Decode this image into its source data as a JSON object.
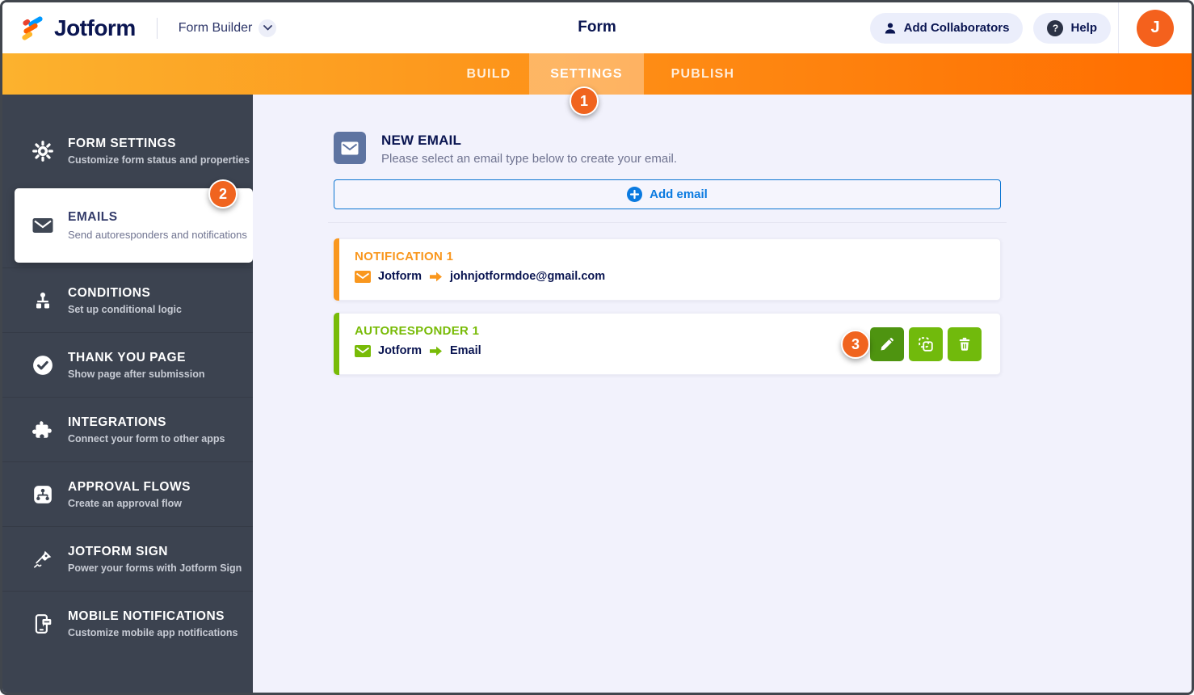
{
  "header": {
    "brand": "Jotform",
    "product": "Form Builder",
    "page_title": "Form",
    "add_collaborators": "Add Collaborators",
    "help": "Help",
    "avatar_initial": "J"
  },
  "nav": {
    "tabs": [
      {
        "label": "BUILD"
      },
      {
        "label": "SETTINGS"
      },
      {
        "label": "PUBLISH"
      }
    ],
    "settings_badge": "1"
  },
  "sidebar": {
    "items": [
      {
        "label": "FORM SETTINGS",
        "description": "Customize form status and properties",
        "icon": "gear-icon"
      },
      {
        "label": "EMAILS",
        "description": "Send autoresponders and notifications",
        "icon": "envelope-icon",
        "badge": "2"
      },
      {
        "label": "CONDITIONS",
        "description": "Set up conditional logic",
        "icon": "sitemap-icon"
      },
      {
        "label": "THANK YOU PAGE",
        "description": "Show page after submission",
        "icon": "check-circle-icon"
      },
      {
        "label": "INTEGRATIONS",
        "description": "Connect your form to other apps",
        "icon": "puzzle-icon"
      },
      {
        "label": "APPROVAL FLOWS",
        "description": "Create an approval flow",
        "icon": "approval-flow-icon"
      },
      {
        "label": "JOTFORM SIGN",
        "description": "Power your forms with Jotform Sign",
        "icon": "signature-pen-icon"
      },
      {
        "label": "MOBILE NOTIFICATIONS",
        "description": "Customize mobile app notifications",
        "icon": "mobile-phone-icon"
      }
    ]
  },
  "main": {
    "new_email": {
      "title": "NEW EMAIL",
      "subtitle": "Please select an email type below to create your email.",
      "add_button": "Add email"
    },
    "emails": [
      {
        "title": "NOTIFICATION 1",
        "from": "Jotform",
        "to": "johnjotformdoe@gmail.com",
        "accent": "#f9971e"
      },
      {
        "title": "AUTORESPONDER 1",
        "from": "Jotform",
        "to": "Email",
        "accent": "#78bb07",
        "badge": "3",
        "actions": [
          {
            "icon": "edit-pencil-icon"
          },
          {
            "icon": "duplicate-icon"
          },
          {
            "icon": "trash-icon"
          }
        ]
      }
    ]
  },
  "colors": {
    "nav_gradient_start": "#fcb22e",
    "nav_gradient_end": "#ff6d00",
    "badge_orange": "#f0641f",
    "avatar_bg": "#f4611d",
    "sidebar_bg": "#3c4350",
    "new_email_icon_bg": "#5e74a1",
    "add_email_blue": "#0a7ae0",
    "action_green": "#71ba0c",
    "action_green_dark": "#4e9410",
    "notification_accent": "#f9971e",
    "autoresponder_accent": "#78bb07"
  }
}
